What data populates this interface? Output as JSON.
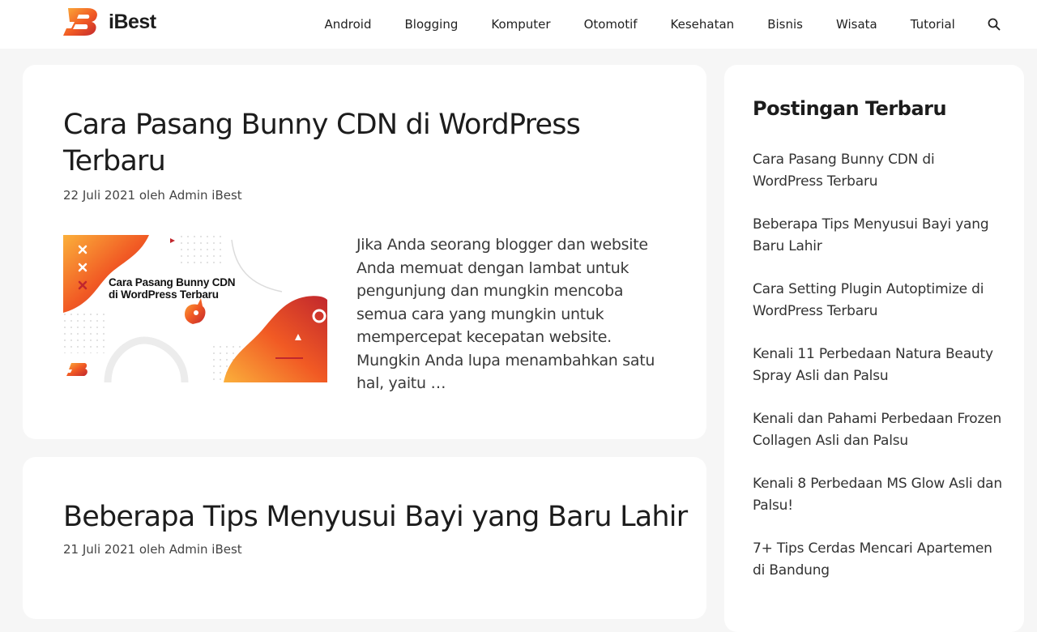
{
  "site": {
    "name": "iBest",
    "brand_colors": {
      "orange": "#f15a24",
      "yellow": "#fbb03b",
      "red": "#c1272d"
    }
  },
  "nav": {
    "items": [
      {
        "label": "Android"
      },
      {
        "label": "Blogging"
      },
      {
        "label": "Komputer"
      },
      {
        "label": "Otomotif"
      },
      {
        "label": "Kesehatan"
      },
      {
        "label": "Bisnis"
      },
      {
        "label": "Wisata"
      },
      {
        "label": "Tutorial"
      }
    ],
    "search_icon": "search-icon"
  },
  "posts": [
    {
      "title": "Cara Pasang Bunny CDN di WordPress Terbaru",
      "date": "22 Juli 2021",
      "by": "oleh",
      "author": "Admin iBest",
      "thumbnail_text_line1": "Cara Pasang Bunny CDN",
      "thumbnail_text_line2": "di WordPress Terbaru",
      "excerpt": "Jika Anda seorang blogger dan website Anda memuat dengan lambat untuk pengunjung dan mungkin mencoba semua cara yang mungkin untuk mempercepat kecepatan website. Mungkin Anda lupa menambahkan satu hal, yaitu …"
    },
    {
      "title": "Beberapa Tips Menyusui Bayi yang Baru Lahir",
      "date": "21 Juli 2021",
      "by": "oleh",
      "author": "Admin iBest"
    }
  ],
  "sidebar": {
    "title": "Postingan Terbaru",
    "items": [
      {
        "label": "Cara Pasang Bunny CDN di WordPress Terbaru"
      },
      {
        "label": "Beberapa Tips Menyusui Bayi yang Baru Lahir"
      },
      {
        "label": "Cara Setting Plugin Autoptimize di WordPress Terbaru"
      },
      {
        "label": "Kenali 11 Perbedaan Natura Beauty Spray Asli dan Palsu"
      },
      {
        "label": "Kenali dan Pahami Perbedaan Frozen Collagen Asli dan Palsu"
      },
      {
        "label": "Kenali 8 Perbedaan MS Glow Asli dan Palsu!"
      },
      {
        "label": "7+ Tips Cerdas Mencari Apartemen di Bandung"
      }
    ]
  }
}
